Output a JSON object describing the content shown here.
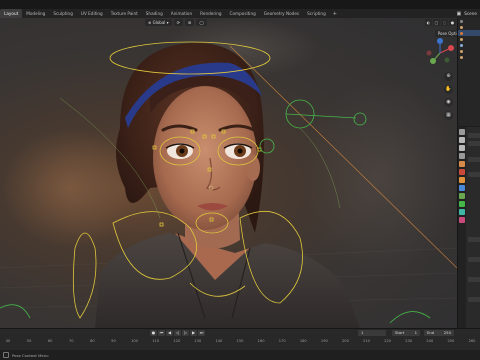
{
  "workspace_tabs": [
    {
      "label": "Layout",
      "active": true
    },
    {
      "label": "Modeling",
      "active": false
    },
    {
      "label": "Sculpting",
      "active": false
    },
    {
      "label": "UV Editing",
      "active": false
    },
    {
      "label": "Texture Paint",
      "active": false
    },
    {
      "label": "Shading",
      "active": false
    },
    {
      "label": "Animation",
      "active": false
    },
    {
      "label": "Rendering",
      "active": false
    },
    {
      "label": "Compositing",
      "active": false
    },
    {
      "label": "Geometry Nodes",
      "active": false
    },
    {
      "label": "Scripting",
      "active": false
    }
  ],
  "add_workspace": "+",
  "scene_label": "Scene",
  "viewport": {
    "transform_orientation": "Global",
    "pose_options": "Pose Options"
  },
  "nav_icons": [
    "zoom-icon",
    "hand-icon",
    "camera-icon",
    "grid-icon"
  ],
  "timeline": {
    "current_frame": "1",
    "start_label": "Start",
    "start_value": "1",
    "end_label": "End",
    "end_value": "250",
    "ruler_ticks": [
      "40",
      "50",
      "60",
      "70",
      "80",
      "90",
      "100",
      "110",
      "120",
      "130",
      "140",
      "150",
      "160",
      "170",
      "180",
      "190",
      "200",
      "210",
      "220",
      "230",
      "240",
      "250",
      "260"
    ]
  },
  "status": {
    "left_text": "Pose Context Menu"
  },
  "colors": {
    "accent": "#4d6fa3",
    "rig_yellow": "#e0c83c",
    "rig_green": "#46b64a",
    "gizmo_x": "#d8484f",
    "gizmo_y": "#6aa84f",
    "gizmo_z": "#3c74d0"
  }
}
